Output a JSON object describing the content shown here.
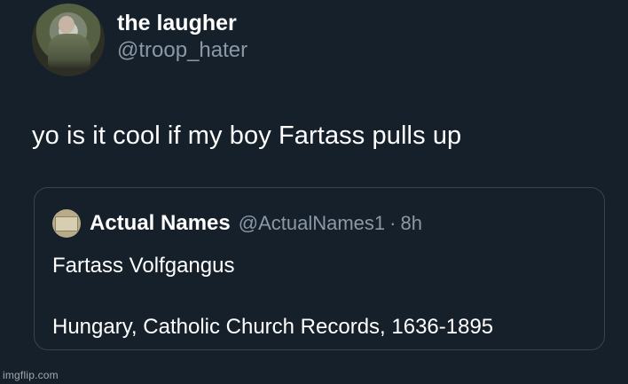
{
  "tweet": {
    "author": {
      "display_name": "the laugher",
      "handle": "@troop_hater",
      "avatar_icon": "soldier-profile-photo"
    },
    "text": "yo is it cool if my boy Fartass pulls up",
    "quoted_tweet": {
      "avatar_icon": "old-document-avatar",
      "display_name": "Actual Names",
      "handle": "@ActualNames1",
      "separator": "·",
      "time": "8h",
      "line1": "Fartass Volfgangus",
      "line2": "Hungary, Catholic Church Records, 1636-1895"
    }
  },
  "watermark": "imgflip.com",
  "colors": {
    "background": "#15202b",
    "primary_text": "#ffffff",
    "secondary_text": "#8b98a5",
    "border": "#38444d"
  }
}
